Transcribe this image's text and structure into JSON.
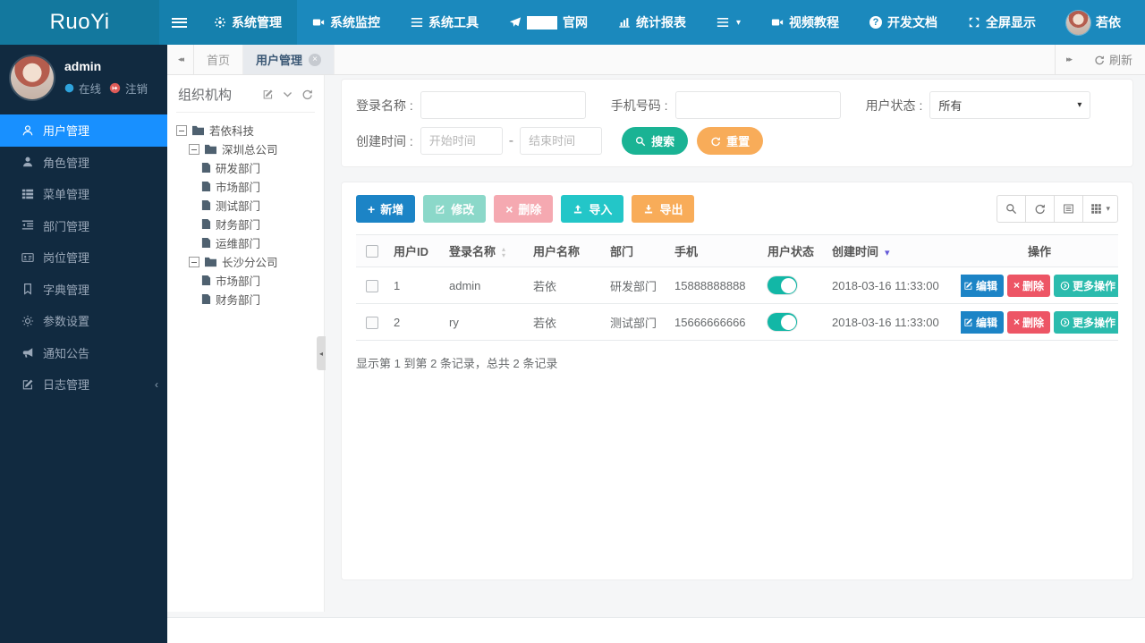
{
  "navbar": {
    "brand": "RuoYi",
    "menu_system": "系统管理",
    "menu_monitor": "系统监控",
    "menu_tools": "系统工具",
    "menu_site": "官网",
    "menu_report": "统计报表",
    "link_video": "视频教程",
    "link_docs": "开发文档",
    "link_fullscreen": "全屏显示",
    "username": "若依"
  },
  "sidebar": {
    "user": {
      "name": "admin",
      "status": "在线",
      "logout": "注销"
    },
    "menu": [
      {
        "label": "用户管理"
      },
      {
        "label": "角色管理"
      },
      {
        "label": "菜单管理"
      },
      {
        "label": "部门管理"
      },
      {
        "label": "岗位管理"
      },
      {
        "label": "字典管理"
      },
      {
        "label": "参数设置"
      },
      {
        "label": "通知公告"
      },
      {
        "label": "日志管理"
      }
    ]
  },
  "tabs": {
    "items": [
      {
        "label": "首页"
      },
      {
        "label": "用户管理"
      }
    ],
    "refresh_label": "刷新"
  },
  "tree_panel": {
    "title": "组织机构",
    "nodes": [
      {
        "label": "若依科技"
      },
      {
        "label": "深圳总公司"
      },
      {
        "label": "研发部门"
      },
      {
        "label": "市场部门"
      },
      {
        "label": "测试部门"
      },
      {
        "label": "财务部门"
      },
      {
        "label": "运维部门"
      },
      {
        "label": "长沙分公司"
      },
      {
        "label": "市场部门"
      },
      {
        "label": "财务部门"
      }
    ]
  },
  "search": {
    "login_label": "登录名称 :",
    "phone_label": "手机号码 :",
    "status_label": "用户状态 :",
    "status_value": "所有",
    "time_label": "创建时间 :",
    "start_placeholder": "开始时间",
    "end_placeholder": "结束时间",
    "date_separator": "-",
    "search_btn": "搜索",
    "reset_btn": "重置"
  },
  "toolbar": {
    "add": "新增",
    "edit": "修改",
    "delete": "删除",
    "import": "导入",
    "export": "导出"
  },
  "table": {
    "headers": [
      "用户ID",
      "登录名称",
      "用户名称",
      "部门",
      "手机",
      "用户状态",
      "创建时间",
      "操作"
    ],
    "rows": [
      {
        "id": "1",
        "login": "admin",
        "name": "若依",
        "dept": "研发部门",
        "phone": "15888888888",
        "status": "on",
        "created": "2018-03-16 11:33:00"
      },
      {
        "id": "2",
        "login": "ry",
        "name": "若依",
        "dept": "测试部门",
        "phone": "15666666666",
        "status": "on",
        "created": "2018-03-16 11:33:00"
      }
    ],
    "row_actions": {
      "edit": "编辑",
      "delete": "删除",
      "more": "更多操作"
    },
    "summary": "显示第 1 到第 2 条记录，总共 2 条记录"
  },
  "colors": {
    "navbar": "#1b89bd",
    "logo_bg": "#13789e",
    "sidebar_bg": "#112a40",
    "sidebar_active": "#1890ff",
    "green": "#1ab394",
    "orange": "#f8ac59",
    "blue": "#1c84c6",
    "teal": "#23c6c8",
    "red": "#ed5565",
    "toggle_on": "#12b7a6"
  }
}
